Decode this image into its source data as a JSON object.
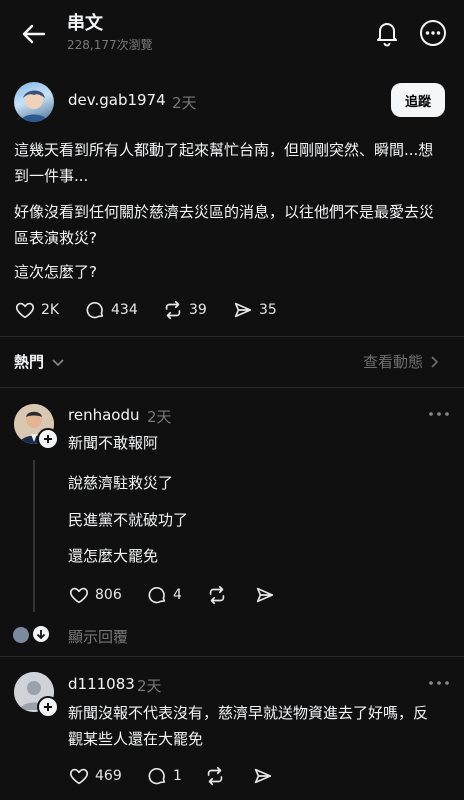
{
  "header": {
    "title": "串文",
    "views": "228,177次瀏覽"
  },
  "post": {
    "username": "dev.gab1974",
    "time": "2天",
    "follow_label": "追蹤",
    "paragraphs": [
      "這幾天看到所有人都動了起來幫忙台南，但剛剛突然、瞬間...想到一件事...",
      "好像沒看到任何關於慈濟去災區的消息，以往他們不是最愛去災區表演救災?",
      "這次怎麼了?"
    ],
    "likes": "2K",
    "comments": "434",
    "reposts": "39",
    "shares": "35"
  },
  "sort": {
    "label": "熱門",
    "activity_label": "查看動態"
  },
  "comments": [
    {
      "username": "renhaodu",
      "time": "2天",
      "lines": [
        "新聞不敢報阿",
        "說慈濟駐救災了",
        "民進黨不就破功了",
        "還怎麼大罷免"
      ],
      "likes": "806",
      "replies": "4",
      "show_replies_label": "顯示回覆"
    },
    {
      "username": "d111083",
      "time": "2天",
      "lines": [
        "新聞沒報不代表沒有，慈濟早就送物資進去了好嗎，反觀某些人還在大罷免"
      ],
      "likes": "469",
      "replies": "1"
    }
  ],
  "colors": {
    "background": "#101010",
    "text": "#f3f5f7",
    "muted": "#777777"
  }
}
